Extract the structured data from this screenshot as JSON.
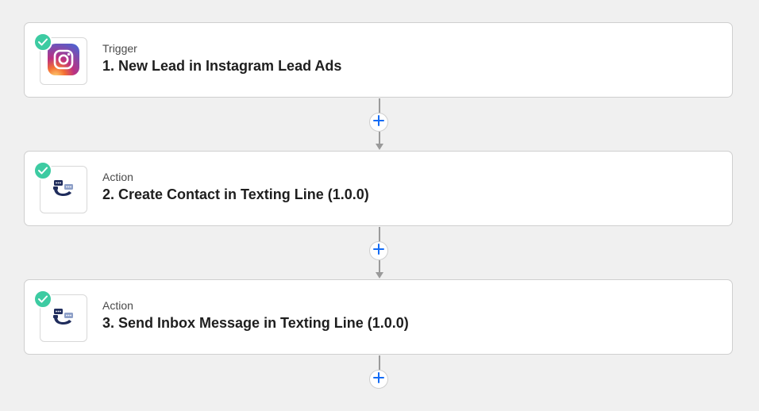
{
  "steps": [
    {
      "kind": "Trigger",
      "title": "1. New Lead in Instagram Lead Ads",
      "app_icon": "instagram-icon",
      "status": "complete"
    },
    {
      "kind": "Action",
      "title": "2. Create Contact in Texting Line (1.0.0)",
      "app_icon": "texting-line-icon",
      "status": "complete"
    },
    {
      "kind": "Action",
      "title": "3. Send Inbox Message in Texting Line (1.0.0)",
      "app_icon": "texting-line-icon",
      "status": "complete"
    }
  ],
  "colors": {
    "check_badge": "#3dcba2",
    "add_plus": "#136bf5",
    "connector": "#9a9a9a",
    "texting_line_navy": "#1f2c5c",
    "texting_line_bubble": "#8ea0c8"
  }
}
